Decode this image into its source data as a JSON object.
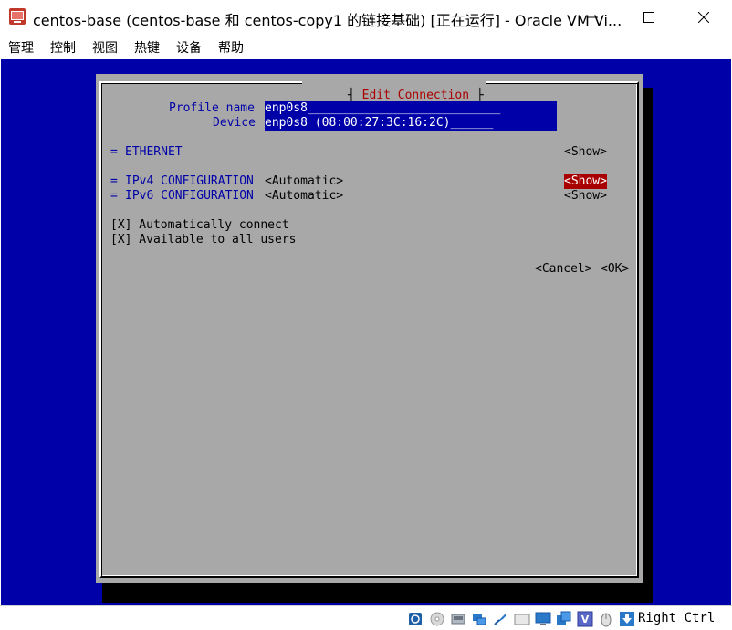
{
  "window": {
    "title": "centos-base (centos-base 和 centos-copy1 的链接基础) [正在运行] - Oracle VM Vi...",
    "icon": "virtualbox-vm-icon",
    "controls": [
      "minimize-icon",
      "maximize-icon",
      "close-icon"
    ]
  },
  "menu": {
    "items": [
      "管理",
      "控制",
      "视图",
      "热键",
      "设备",
      "帮助"
    ]
  },
  "dialog": {
    "title": "Edit Connection",
    "profile_name_label": "Profile name",
    "profile_name_value": "enp0s8___________________________",
    "device_label": "Device",
    "device_value": "enp0s8 (08:00:27:3C:16:2C)______",
    "ethernet": {
      "marker": "=",
      "label": "ETHERNET",
      "button": "<Show>"
    },
    "ipv4": {
      "marker": "=",
      "label": "IPv4 CONFIGURATION",
      "mode": "<Automatic>",
      "button": "<Show>"
    },
    "ipv6": {
      "marker": "=",
      "label": "IPv6 CONFIGURATION",
      "mode": "<Automatic>",
      "button": "<Show>"
    },
    "auto_connect": "[X] Automatically connect",
    "all_users": "[X] Available to all users",
    "cancel_button": "<Cancel>",
    "ok_button": "<OK>"
  },
  "statusbar": {
    "icons": [
      "hard-disk-icon",
      "optical-drive-icon",
      "audio-icon",
      "network-icon",
      "usb-icon",
      "shared-folder-icon",
      "display-icon",
      "video-capture-icon",
      "virtualization-icon",
      "mouse-integration-icon"
    ],
    "host_key": "Right Ctrl"
  },
  "colors": {
    "screen_bg": "#0000a8",
    "dialog_bg": "#a8a8a8",
    "title_red": "#a80000",
    "selected_bg": "#a80000"
  }
}
